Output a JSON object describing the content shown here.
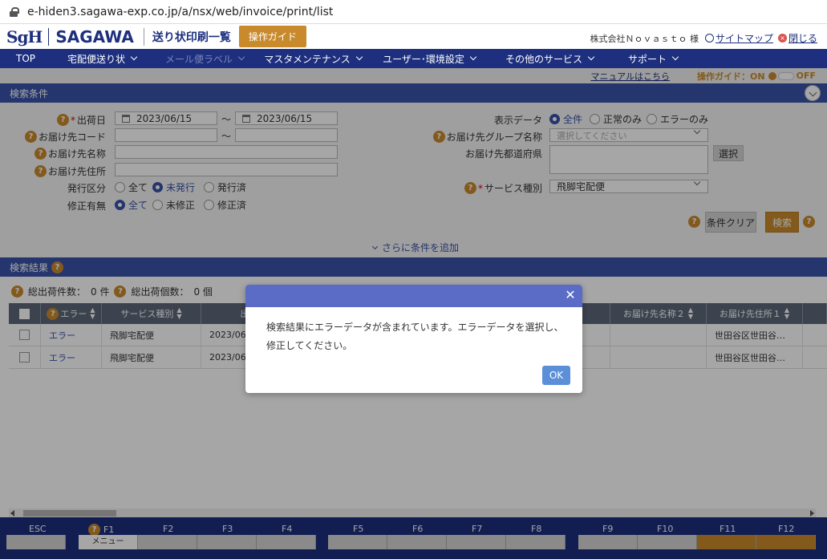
{
  "browser": {
    "url": "e-hiden3.sagawa-exp.co.jp/a/nsx/web/invoice/print/list"
  },
  "header": {
    "logo_sgh": "SgH",
    "logo_sagawa": "SAGAWA",
    "page_title": "送り状印刷一覧",
    "guide_button": "操作ガイド",
    "company": "株式会社Ｎｏｖａｓｔｏ 様",
    "sitemap": "サイトマップ",
    "close": "閉じる"
  },
  "nav": {
    "items": [
      {
        "label": "TOP"
      },
      {
        "label": "宅配便送り状"
      },
      {
        "label": "メール便ラベル"
      },
      {
        "label": "マスタメンテナンス"
      },
      {
        "label": "ユーザー･環境設定"
      },
      {
        "label": "その他のサービス"
      },
      {
        "label": "サポート"
      }
    ]
  },
  "guide_row": {
    "manual": "マニュアルはこちら",
    "guide_label": "操作ガイド：ON",
    "off": "OFF"
  },
  "search": {
    "title": "検索条件",
    "ship_date_label": "出荷日",
    "date_from": "2023/06/15",
    "date_to": "2023/06/15",
    "tilde": "～",
    "dest_code_label": "お届け先コード",
    "dest_name_label": "お届け先名称",
    "dest_addr_label": "お届け先住所",
    "issue_label": "発行区分",
    "issue_options": [
      "全て",
      "未発行",
      "発行済"
    ],
    "modify_label": "修正有無",
    "modify_options": [
      "全て",
      "未修正",
      "修正済"
    ],
    "display_label": "表示データ",
    "display_options": [
      "全件",
      "正常のみ",
      "エラーのみ"
    ],
    "group_label": "お届け先グループ名称",
    "group_placeholder": "選択してください",
    "pref_label": "お届け先都道府県",
    "select_button": "選択",
    "service_label": "サービス種別",
    "service_value": "飛脚宅配便",
    "clear_button": "条件クリア",
    "search_button": "検索",
    "add_condition": "さらに条件を追加"
  },
  "results": {
    "title": "検索結果",
    "total_count_label": "総出荷件数：",
    "total_count": "0 件",
    "total_pieces_label": "総出荷個数：",
    "total_pieces": "0 個",
    "columns": [
      "エラー",
      "サービス種別",
      "出荷",
      "お届け先名称２",
      "お届け先住所１"
    ],
    "rows": [
      {
        "error": "エラー",
        "service": "飛脚宅配便",
        "date": "2023/06",
        "addr": "世田谷区世田谷…"
      },
      {
        "error": "エラー",
        "service": "飛脚宅配便",
        "date": "2023/06",
        "addr": "世田谷区世田谷…"
      }
    ]
  },
  "fkeys": {
    "labels": [
      "ESC",
      "F1",
      "F2",
      "F3",
      "F4",
      "F5",
      "F6",
      "F7",
      "F8",
      "F9",
      "F10",
      "F11",
      "F12"
    ],
    "f1_button": "メニュー"
  },
  "modal": {
    "message": "検索結果にエラーデータが含まれています。エラーデータを選択し、修正してください。",
    "ok": "OK"
  },
  "colors": {
    "brand": "#1d2f7e",
    "accent": "#c98a2b",
    "modal_header": "#5b6cc7"
  }
}
